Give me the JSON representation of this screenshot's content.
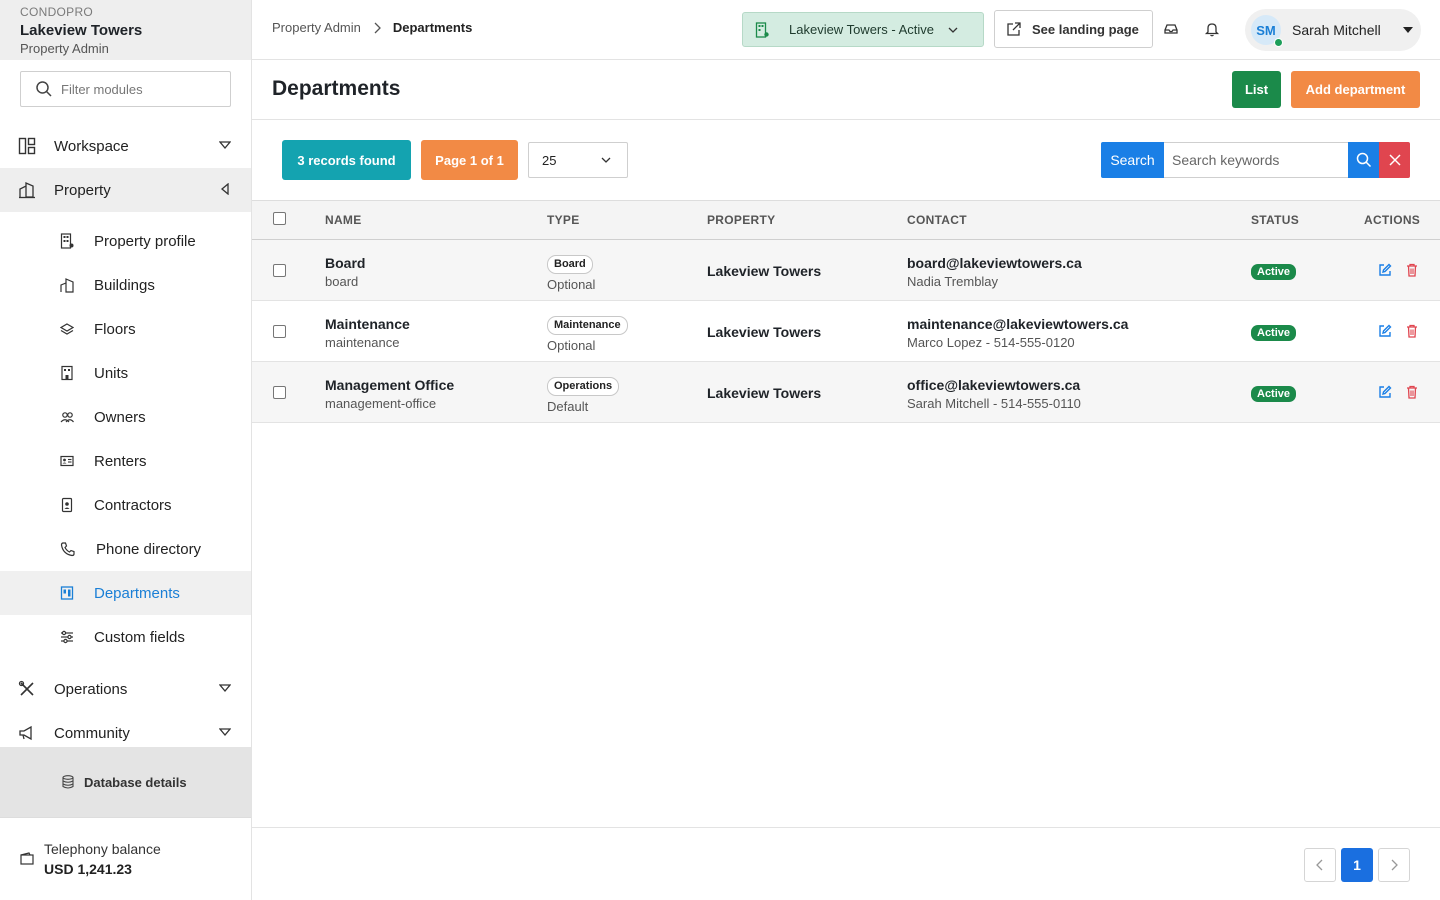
{
  "sidebar": {
    "brand": "CONDOPRO",
    "property_name": "Lakeview Towers",
    "role": "Property Admin",
    "filter_placeholder": "Filter modules",
    "sections": [
      {
        "label": "Workspace",
        "icon": "layout-icon",
        "state": "collapsed"
      },
      {
        "label": "Property",
        "icon": "building-icon",
        "state": "expanded"
      },
      {
        "label": "Operations",
        "icon": "tools-icon",
        "state": "collapsed"
      },
      {
        "label": "Community",
        "icon": "megaphone-icon",
        "state": "collapsed"
      }
    ],
    "property_items": [
      {
        "label": "Property profile",
        "icon": "building-profile-icon"
      },
      {
        "label": "Buildings",
        "icon": "buildings-icon"
      },
      {
        "label": "Floors",
        "icon": "layers-icon"
      },
      {
        "label": "Units",
        "icon": "unit-icon"
      },
      {
        "label": "Owners",
        "icon": "owners-icon"
      },
      {
        "label": "Renters",
        "icon": "id-card-icon"
      },
      {
        "label": "Contractors",
        "icon": "badge-icon"
      },
      {
        "label": "Phone directory",
        "icon": "phone-icon"
      },
      {
        "label": "Departments",
        "icon": "departments-icon",
        "active": true
      },
      {
        "label": "Custom fields",
        "icon": "sliders-icon"
      }
    ],
    "database_label": "Database details",
    "telephony_label": "Telephony balance",
    "telephony_value": "USD 1,241.23"
  },
  "header": {
    "breadcrumb_parent": "Property Admin",
    "breadcrumb_current": "Departments",
    "property_selector": "Lakeview Towers - Active",
    "landing_button": "See landing page",
    "user_initials": "SM",
    "user_name": "Sarah Mitchell"
  },
  "page": {
    "title": "Departments",
    "list_button": "List",
    "add_button": "Add department"
  },
  "toolbar": {
    "records_found": "3 records found",
    "page_info": "Page 1 of 1",
    "per_page": "25",
    "search_label": "Search",
    "search_placeholder": "Search keywords"
  },
  "table": {
    "columns": [
      "NAME",
      "TYPE",
      "PROPERTY",
      "CONTACT",
      "STATUS",
      "ACTIONS"
    ],
    "rows": [
      {
        "name": "Board",
        "slug": "board",
        "type_badge": "Board",
        "type_mode": "Optional",
        "property": "Lakeview Towers",
        "email": "board@lakeviewtowers.ca",
        "contact": "Nadia Tremblay",
        "status": "Active"
      },
      {
        "name": "Maintenance",
        "slug": "maintenance",
        "type_badge": "Maintenance",
        "type_mode": "Optional",
        "property": "Lakeview Towers",
        "email": "maintenance@lakeviewtowers.ca",
        "contact": "Marco Lopez - 514-555-0120",
        "status": "Active"
      },
      {
        "name": "Management Office",
        "slug": "management-office",
        "type_badge": "Operations",
        "type_mode": "Default",
        "property": "Lakeview Towers",
        "email": "office@lakeviewtowers.ca",
        "contact": "Sarah Mitchell - 514-555-0110",
        "status": "Active"
      }
    ]
  },
  "pagination": {
    "current": "1"
  },
  "colors": {
    "primary": "#1a7fe6",
    "success": "#1b8a4a",
    "accent": "#f28a45",
    "info": "#14a3b0",
    "danger": "#e0454f"
  }
}
